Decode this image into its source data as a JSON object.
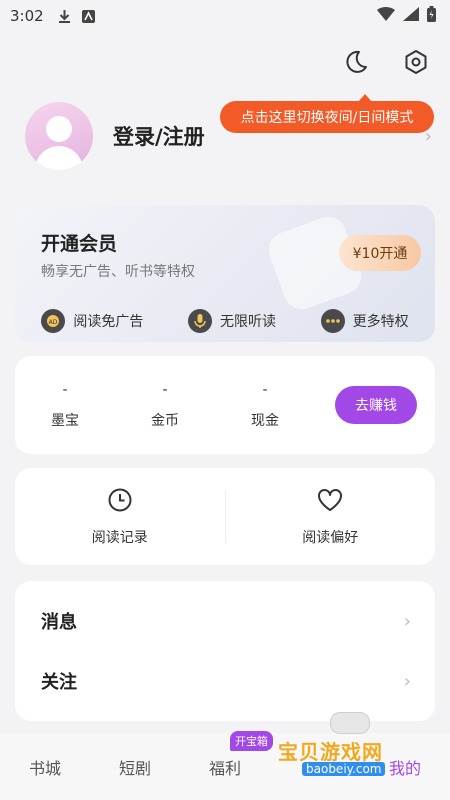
{
  "status_bar": {
    "time": "3:02"
  },
  "tooltip": {
    "text": "点击这里切换夜间/日间模式"
  },
  "profile": {
    "login_label": "登录/注册"
  },
  "vip": {
    "title": "开通会员",
    "subtitle": "畅享无广告、听书等特权",
    "button": "¥10开通",
    "perks": [
      {
        "icon": "ad-free-icon",
        "label": "阅读免广告"
      },
      {
        "icon": "microphone-icon",
        "label": "无限听读"
      },
      {
        "icon": "more-dots-icon",
        "label": "更多特权"
      }
    ]
  },
  "wallet": {
    "items": [
      {
        "value": "-",
        "label": "墨宝"
      },
      {
        "value": "-",
        "label": "金币"
      },
      {
        "value": "-",
        "label": "现金"
      }
    ],
    "earn_button": "去赚钱"
  },
  "records": {
    "history": "阅读记录",
    "preferences": "阅读偏好"
  },
  "menu": {
    "messages": "消息",
    "follow": "关注"
  },
  "tabbar": {
    "tabs": [
      "书城",
      "短剧",
      "福利",
      "",
      "我的"
    ],
    "badge": "开宝箱"
  },
  "watermark": {
    "title": "宝贝游戏网",
    "url": "baobeiy.com"
  },
  "colors": {
    "accent": "#a248e6",
    "tooltip": "#f25a27"
  }
}
